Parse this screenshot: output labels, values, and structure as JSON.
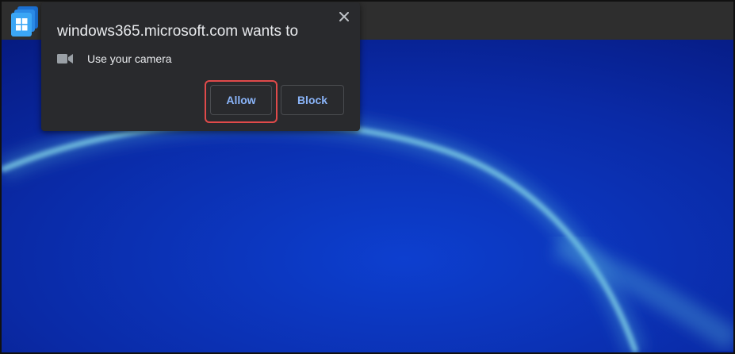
{
  "app": {
    "icon": "windows365-app-icon"
  },
  "permission_prompt": {
    "title": "windows365.microsoft.com wants to",
    "permission_label": "Use your camera",
    "permission_icon": "camera-icon",
    "allow_label": "Allow",
    "block_label": "Block",
    "close_icon": "close-icon"
  },
  "colors": {
    "desktop_background": "#0a2aa6",
    "prompt_background": "#292a2d",
    "button_text": "#8ab4f8",
    "highlight": "#e04a4a",
    "titlebar": "#2e2e2e"
  }
}
